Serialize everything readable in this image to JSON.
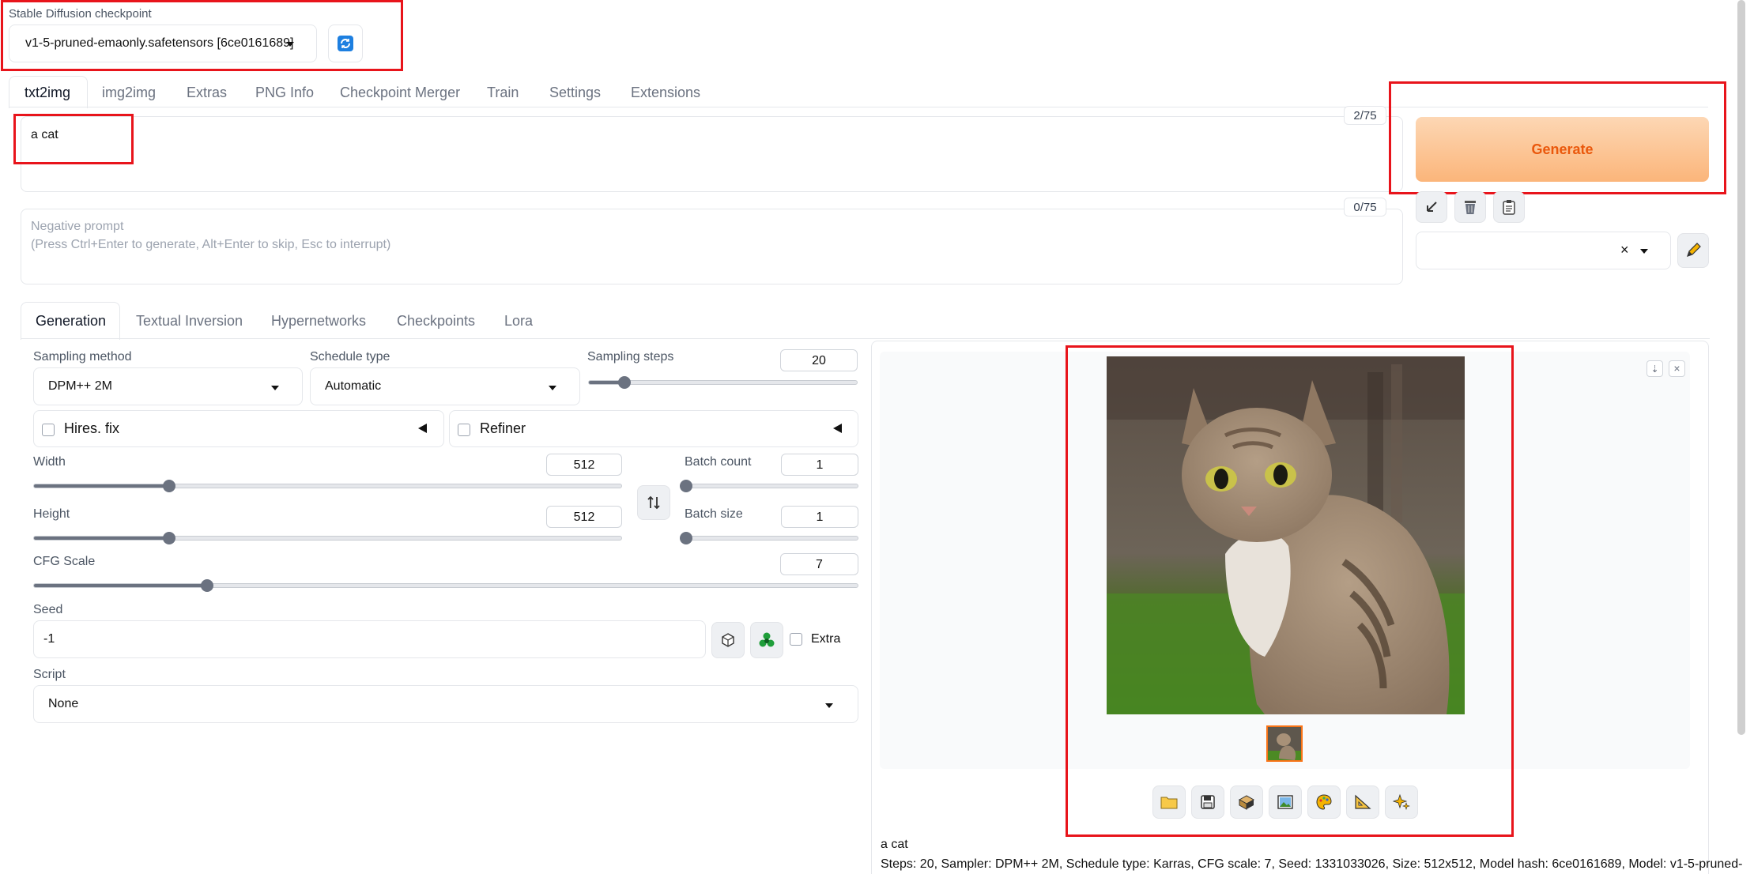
{
  "checkpoint": {
    "label": "Stable Diffusion checkpoint",
    "value": "v1-5-pruned-emaonly.safetensors [6ce0161689]"
  },
  "main_tabs": [
    "txt2img",
    "img2img",
    "Extras",
    "PNG Info",
    "Checkpoint Merger",
    "Train",
    "Settings",
    "Extensions"
  ],
  "prompt": {
    "value": "a cat",
    "counter": "2/75"
  },
  "negative_prompt": {
    "placeholder_line1": "Negative prompt",
    "placeholder_line2": "(Press Ctrl+Enter to generate, Alt+Enter to skip, Esc to interrupt)",
    "counter": "0/75"
  },
  "generate": {
    "label": "Generate"
  },
  "style_select": {
    "clear_symbol": "×"
  },
  "sub_tabs": [
    "Generation",
    "Textual Inversion",
    "Hypernetworks",
    "Checkpoints",
    "Lora"
  ],
  "generation": {
    "sampling_method": {
      "label": "Sampling method",
      "value": "DPM++ 2M"
    },
    "schedule_type": {
      "label": "Schedule type",
      "value": "Automatic"
    },
    "sampling_steps": {
      "label": "Sampling steps",
      "value": "20",
      "fraction": 0.133
    },
    "hires_fix": {
      "label": "Hires. fix"
    },
    "refiner": {
      "label": "Refiner"
    },
    "width": {
      "label": "Width",
      "value": "512",
      "fraction": 0.23
    },
    "height": {
      "label": "Height",
      "value": "512",
      "fraction": 0.23
    },
    "batch_count": {
      "label": "Batch count",
      "value": "1",
      "fraction": 0.0
    },
    "batch_size": {
      "label": "Batch size",
      "value": "1",
      "fraction": 0.0
    },
    "cfg_scale": {
      "label": "CFG Scale",
      "value": "7",
      "fraction": 0.21
    },
    "seed": {
      "label": "Seed",
      "value": "-1",
      "extra_label": "Extra"
    },
    "script": {
      "label": "Script",
      "value": "None"
    }
  },
  "output": {
    "caption": "a cat",
    "info": "Steps: 20, Sampler: DPM++ 2M, Schedule type: Karras, CFG scale: 7, Seed: 1331033026, Size: 512x512, Model hash: 6ce0161689, Model: v1-5-pruned-"
  },
  "colors": {
    "generate_bg": "#fbc89a",
    "generate_text": "#ea580c",
    "highlight": "#e8141b"
  }
}
